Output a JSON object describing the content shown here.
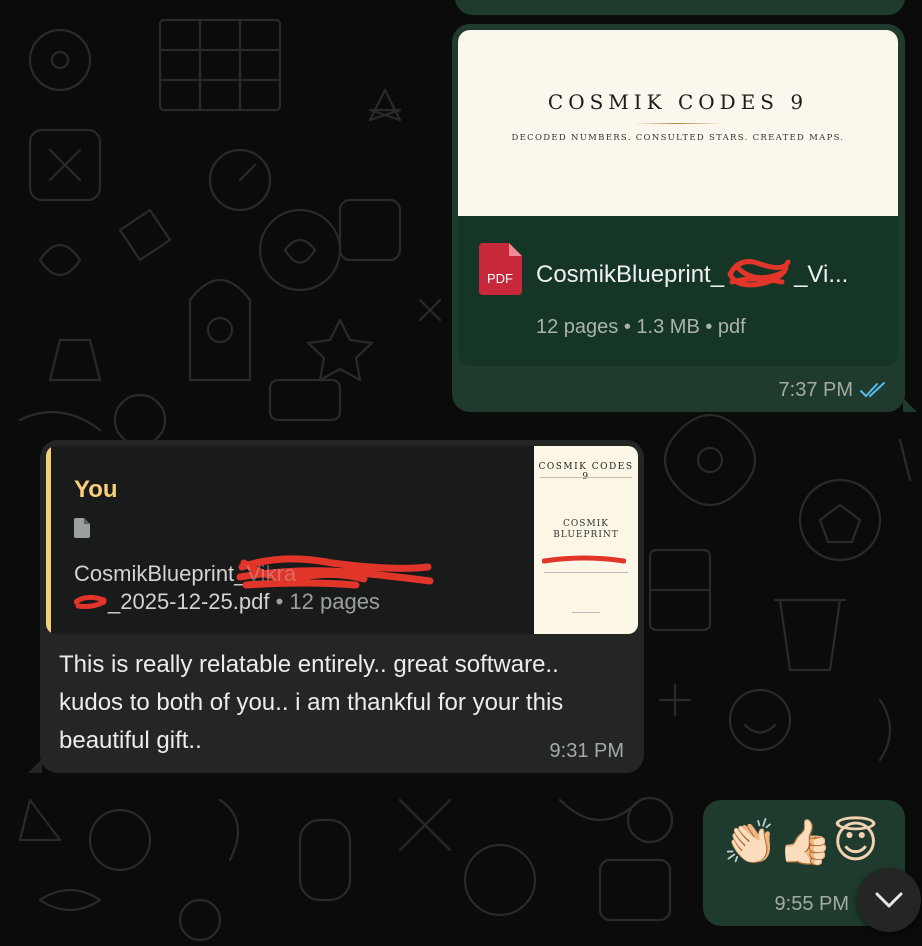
{
  "messages": {
    "document": {
      "preview_title": "COSMIK CODES 9",
      "preview_subtitle": "DECODED NUMBERS. CONSULTED STARS. CREATED MAPS.",
      "file_badge": "PDF",
      "file_name": "CosmikBlueprint_",
      "file_name_tail": "_Vi...",
      "pages": "12 pages",
      "size": "1.3 MB",
      "ext": "pdf",
      "time": "7:37 PM",
      "status": "read"
    },
    "reply": {
      "quote_author": "You",
      "quote_file_name": "CosmikBlueprint_",
      "quote_file_name_tail": "Vikra",
      "quote_file_date": "_2025-12-25.pdf",
      "quote_pages": "12 pages",
      "thumb_title": "COSMIK CODES 9",
      "thumb_mid_line1": "COSMIK",
      "thumb_mid_line2": "BLUEPRINT",
      "text": "This is really relatable entirely.. great software.. kudos to both of you.. i am thankful for your this beautiful gift..",
      "time": "9:31 PM"
    },
    "emoji": {
      "text": "👏🏻👍🏻😇",
      "time": "9:55 PM"
    }
  },
  "colors": {
    "outgoing_bubble": "#1f3b2d",
    "incoming_bubble": "#242626",
    "quote_accent": "#f5cd7d",
    "read_ticks": "#53bdeb",
    "pdf_badge": "#c7283a"
  },
  "icons": {
    "pdf": "pdf-file-icon",
    "file": "file-icon",
    "ticks": "double-check-icon",
    "scroll": "chevron-down-icon"
  }
}
